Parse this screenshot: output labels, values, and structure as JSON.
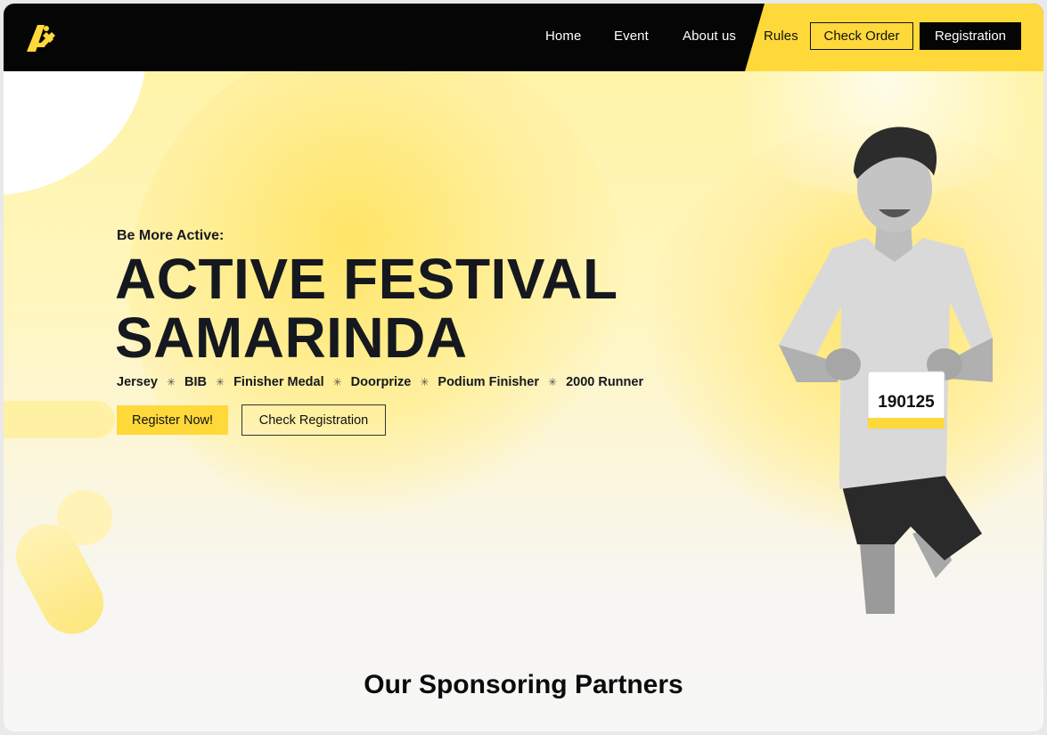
{
  "nav": {
    "links": [
      "Home",
      "Event",
      "About us",
      "Rules"
    ],
    "check_order": "Check Order",
    "registration": "Registration"
  },
  "hero": {
    "kicker": "Be More Active:",
    "title_line1": "ACTIVE FESTIVAL",
    "title_line2": "SAMARINDA",
    "features": [
      "Jersey",
      "BIB",
      "Finisher Medal",
      "Doorprize",
      "Podium Finisher",
      "2000 Runner"
    ],
    "register_button": "Register Now!",
    "check_button": "Check Registration",
    "bib_number": "190125"
  },
  "sponsors": {
    "title": "Our Sponsoring Partners"
  },
  "colors": {
    "accent": "#ffd93a",
    "nav_bg": "#050505",
    "text": "#16181f"
  }
}
